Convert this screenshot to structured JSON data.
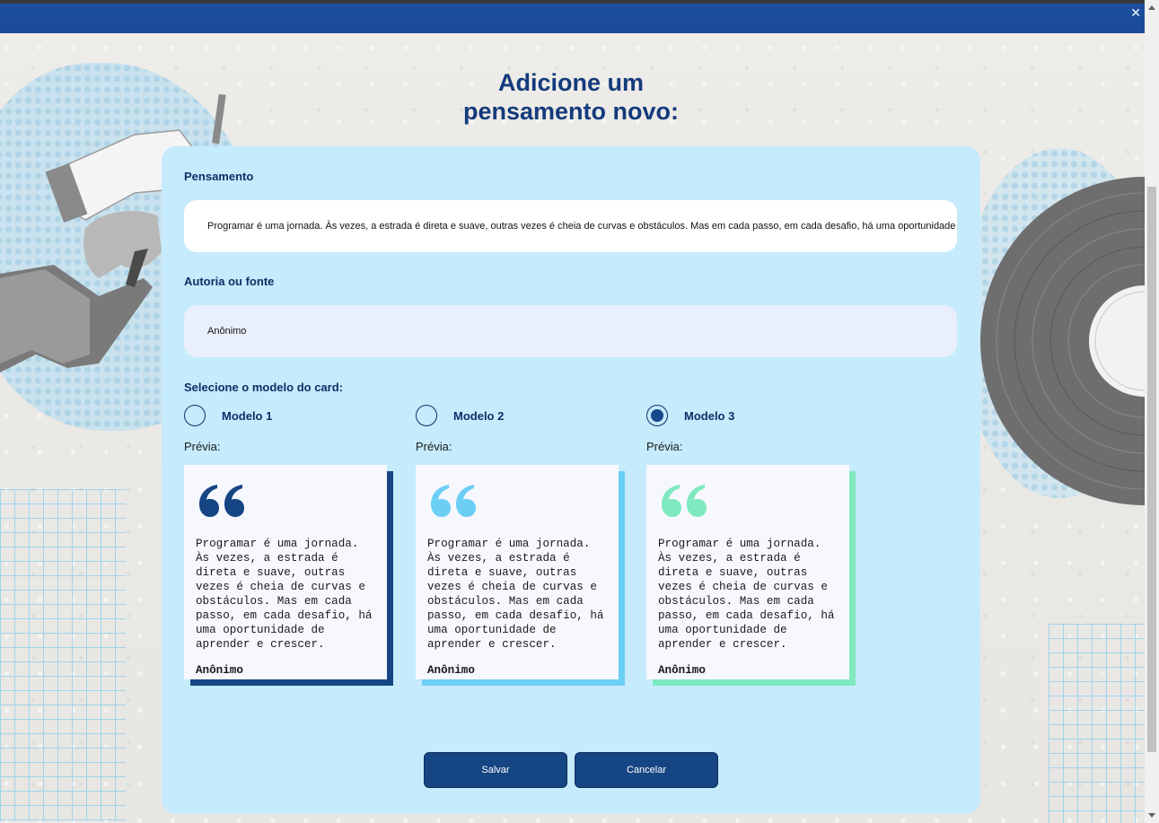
{
  "page": {
    "title_line1": "Adicione um",
    "title_line2": "pensamento novo:"
  },
  "form": {
    "thought_label": "Pensamento",
    "thought_value": "Programar é uma jornada. Às vezes, a estrada é direta e suave, outras vezes é cheia de curvas e obstáculos. Mas em cada passo, em cada desafio, há uma oportunidade",
    "author_label": "Autoria ou fonte",
    "author_value": "Anônimo",
    "model_select_label": "Selecione o modelo do card:",
    "selected_model": 3
  },
  "models": [
    {
      "label": "Modelo 1",
      "preview_label": "Prévia:",
      "accent": "#164583",
      "quote_text": "Programar é uma jornada. Às vezes, a estrada é direta e suave, outras vezes é cheia de curvas e obstáculos. Mas em cada passo, em cada desafio, há uma oportunidade de aprender e crescer.",
      "quote_author": "Anônimo",
      "icon": "quote-icon"
    },
    {
      "label": "Modelo 2",
      "preview_label": "Prévia:",
      "accent": "#6bcef5",
      "quote_text": "Programar é uma jornada. Às vezes, a estrada é direta e suave, outras vezes é cheia de curvas e obstáculos. Mas em cada passo, em cada desafio, há uma oportunidade de aprender e crescer.",
      "quote_author": "Anônimo",
      "icon": "quote-icon"
    },
    {
      "label": "Modelo 3",
      "preview_label": "Prévia:",
      "accent": "#7fe9bf",
      "quote_text": "Programar é uma jornada. Às vezes, a estrada é direta e suave, outras vezes é cheia de curvas e obstáculos. Mas em cada passo, em cada desafio, há uma oportunidade de aprender e crescer.",
      "quote_author": "Anônimo",
      "icon": "quote-icon"
    }
  ],
  "actions": {
    "save_label": "Salvar",
    "cancel_label": "Cancelar"
  },
  "colors": {
    "title": "#133b7c",
    "panel": "#c5ebfc",
    "button": "#164583"
  }
}
